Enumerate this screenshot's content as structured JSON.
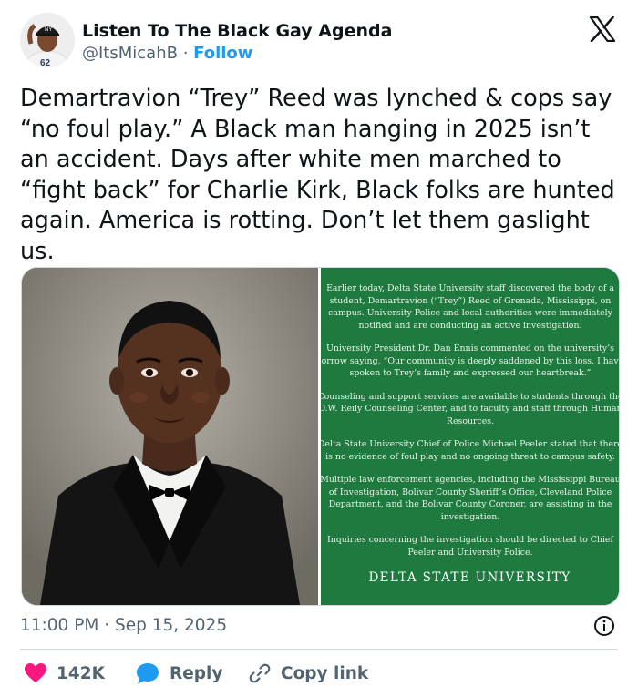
{
  "author": {
    "display_name": "Listen To The Black Gay Agenda",
    "handle": "@ItsMicahB",
    "separator": " · ",
    "follow_label": "Follow"
  },
  "tweet": {
    "text": "Demartravion “Trey” Reed was lynched & cops say “no foul play.” A Black man hanging in 2025 isn’t an accident. Days after white men marched to “fight back” for Charlie Kirk, Black folks are hunted again. America is rotting. Don’t let them gaslight us."
  },
  "media": {
    "statement_paragraphs": [
      "Earlier today, Delta State University staff discovered the body of a student, Demartravion (“Trey”) Reed of Grenada, Mississippi, on campus. University Police and local authorities were immediately notified and are conducting an active investigation.",
      "University President Dr. Dan Ennis commented on the university’s sorrow saying, “Our community is deeply saddened by this loss. I have spoken to Trey’s family and expressed our heartbreak.”",
      "Counseling and support services are available to students through the O.W. Reily Counseling Center, and to faculty and staff through Human Resources.",
      "Delta State University Chief of Police Michael Peeler stated that there is no evidence of foul play and no ongoing threat to campus safety.",
      "Multiple law enforcement agencies, including the Mississippi Bureau of Investigation, Bolivar County Sheriff’s Office, Cleveland Police Department, and the Bolivar County Coroner, are assisting in the investigation.",
      "Inquiries concerning the investigation should be directed to Chief Peeler and University Police."
    ],
    "statement_footer": "DELTA STATE UNIVERSITY",
    "statement_bg_color": "#1f7a3f"
  },
  "meta": {
    "timestamp": "11:00 PM · Sep 15, 2025"
  },
  "actions": {
    "like_count": "142K",
    "reply_label": "Reply",
    "copy_label": "Copy link"
  },
  "icons": {
    "platform_logo": "x-logo-icon",
    "info": "info-icon",
    "like": "heart-icon",
    "reply": "speech-bubble-icon",
    "copy": "link-icon"
  },
  "colors": {
    "accent": "#1d9bf0",
    "like": "#f91880",
    "muted": "#536471",
    "text": "#0f1419"
  }
}
